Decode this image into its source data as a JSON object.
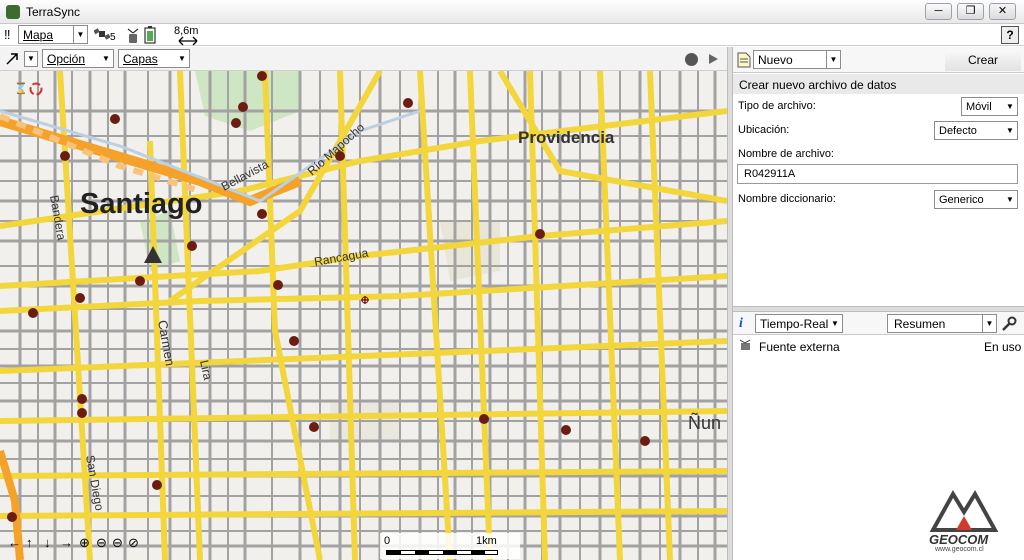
{
  "window": {
    "title": "TerraSync",
    "buttons": [
      "minimize",
      "maximize",
      "close"
    ]
  },
  "toolbar": {
    "section_label": "Mapa",
    "satellite_count": "5",
    "distance": "8,6m",
    "help_label": "?"
  },
  "map_toolbar": {
    "option_label": "Opción",
    "layers_label": "Capas"
  },
  "map": {
    "labels": {
      "santiago": "Santiago",
      "providencia": "Providencia",
      "bellavista": "Bellavista",
      "rio_mapocho": "Río Mapocho",
      "rancagua": "Rancagua",
      "carmen": "Carmen",
      "lira": "Lira",
      "bandera": "Bandera",
      "san_diego": "San Diego",
      "nun": "Ñun"
    },
    "scale": {
      "start": "0",
      "end": "1km"
    }
  },
  "panel": {
    "new_dropdown": "Nuevo",
    "create_button": "Crear",
    "title": "Crear nuevo archivo de datos",
    "fields": {
      "file_type_label": "Tipo de archivo:",
      "file_type_value": "Móvil",
      "location_label": "Ubicación:",
      "location_value": "Defecto",
      "filename_label": "Nombre de archivo:",
      "filename_value": "R042911A",
      "dictionary_label": "Nombre diccionario:",
      "dictionary_value": "Generico"
    }
  },
  "realtime": {
    "mode_dropdown": "Tiempo-Real",
    "view_dropdown": "Resumen",
    "source_label": "Fuente externa",
    "source_status": "En uso"
  },
  "logo": {
    "text": "GEOCOM",
    "url_text": "www.geocom.cl"
  },
  "colors": {
    "road_major": "#f2d63c",
    "road_minor": "#9e9e9e",
    "road_highway": "#f5a22a",
    "park": "#cfe6c4",
    "poi": "#6b1d12"
  }
}
